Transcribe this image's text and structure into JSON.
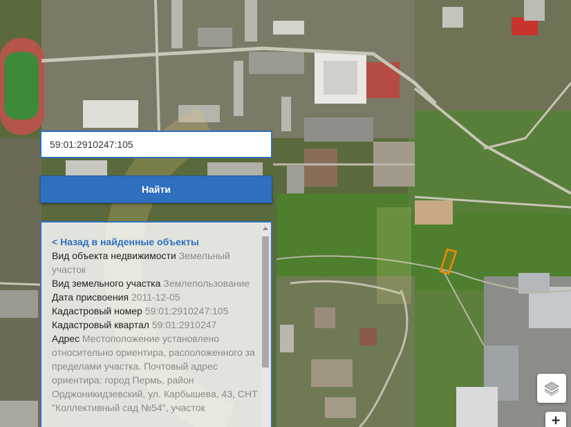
{
  "search": {
    "value": "59:01:2910247:105",
    "button_label": "Найти"
  },
  "info": {
    "back_link": "< Назад в найденные объекты",
    "rows": [
      {
        "label": "Вид объекта недвижимости",
        "value": "Земельный участок"
      },
      {
        "label": "Вид земельного участка",
        "value": "Землепользование"
      },
      {
        "label": "Дата присвоения",
        "value": "2011-12-05"
      },
      {
        "label": "Кадастровый номер",
        "value": "59:01:2910247:105"
      },
      {
        "label": "Кадастровый квартал",
        "value": "59:01:2910247"
      },
      {
        "label": "Адрес",
        "value": "Местоположение установлено относительно ориентира, расположенного за пределами участка. Почтовый адрес ориентира: город Пермь, район Орджоникидзевский, ул. Карбышева, 43, СНТ \"Коллективный сад №54\", участок"
      }
    ]
  },
  "controls": {
    "zoom_in_label": "+"
  },
  "colors": {
    "accent": "#2f6fc0",
    "parcel_outline": "#f08c00"
  }
}
